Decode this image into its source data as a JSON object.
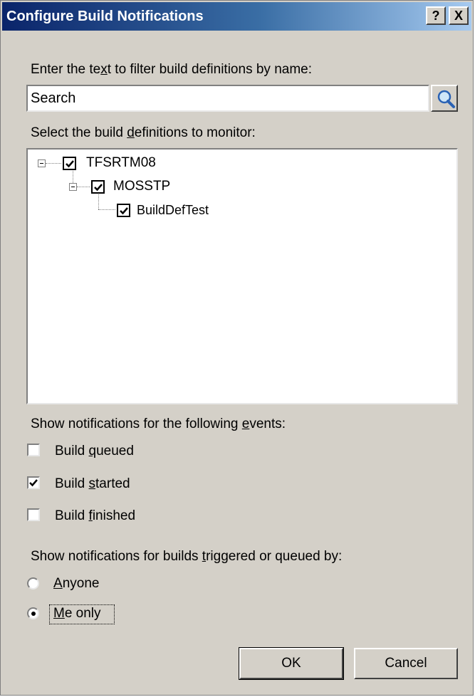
{
  "window": {
    "title": "Configure Build Notifications",
    "help_label": "?",
    "close_label": "X"
  },
  "filter": {
    "label_pre": "Enter the te",
    "label_mnemonic": "x",
    "label_post": "t to filter build definitions by name:",
    "search_value": "Search"
  },
  "definitions": {
    "label_pre": "Select the build ",
    "label_mnemonic": "d",
    "label_post": "efinitions to monitor:",
    "tree": {
      "root": {
        "label": "TFSRTM08",
        "checked": true,
        "expanded": true
      },
      "child": {
        "label": "MOSSTP",
        "checked": true,
        "expanded": true
      },
      "leaf": {
        "label": "BuildDefTest",
        "checked": true
      }
    }
  },
  "events": {
    "label_pre": "Show notifications for the following ",
    "label_mnemonic": "e",
    "label_post": "vents:",
    "queued": {
      "pre": "Build ",
      "mn": "q",
      "post": "ueued",
      "checked": false
    },
    "started": {
      "pre": "Build ",
      "mn": "s",
      "post": "tarted",
      "checked": true
    },
    "finished": {
      "pre": "Build ",
      "mn": "f",
      "post": "inished",
      "checked": false
    }
  },
  "triggered": {
    "label_pre": "Show notifications for builds ",
    "label_mnemonic": "t",
    "label_post": "riggered or queued by:",
    "anyone": {
      "mn": "A",
      "post": "nyone",
      "selected": false
    },
    "me_only": {
      "mn": "M",
      "post": "e only",
      "selected": true
    }
  },
  "buttons": {
    "ok": "OK",
    "cancel": "Cancel"
  },
  "colors": {
    "dialog_bg": "#d4d0c8",
    "title_gradient_start": "#0a246a",
    "title_gradient_end": "#a6caf0"
  },
  "icons": {
    "search": "magnifier-icon",
    "check": "check-mark-icon"
  }
}
